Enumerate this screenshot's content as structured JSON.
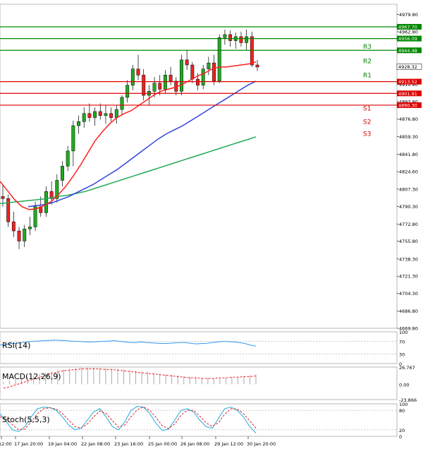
{
  "chart_data": [
    {
      "type": "candlestick",
      "name": "price",
      "ylim": [
        4669.8,
        4990
      ],
      "y_ticks": [
        "4979.80",
        "4962.80",
        "4945.80",
        "4928.80",
        "4910.80",
        "4893.80",
        "4876.80",
        "4859.30",
        "4841.80",
        "4824.60",
        "4807.30",
        "4790.30",
        "4772.80",
        "4755.80",
        "4738.30",
        "4721.30",
        "4704.30",
        "4686.80",
        "4669.80"
      ],
      "x_ticks": [
        "12:00",
        "17 Jan 20:00",
        "19 Jan 04:00",
        "22 Jan 08:00",
        "23 Jan 16:00",
        "25 Jan 00:00",
        "26 Jan 08:00",
        "29 Jan 12:00",
        "30 Jan 20:00"
      ],
      "current_price": "4928.32",
      "colors": {
        "up": "#22aa22",
        "down": "#ee2222",
        "ma_fast": "#ff2020",
        "ma_mid": "#3344dd",
        "ma_slow": "#22aa55",
        "resistance": "#008800",
        "support": "#dd0000"
      },
      "levels": [
        {
          "name": "R3",
          "value": 4967.7,
          "label": "4967.70",
          "kind": "resistance"
        },
        {
          "name": "R2",
          "value": 4956.09,
          "label": "4956.09",
          "kind": "resistance"
        },
        {
          "name": "R1",
          "value": 4944.48,
          "label": "4944.48",
          "kind": "resistance"
        },
        {
          "name": "S1",
          "value": 4913.52,
          "label": "4913.52",
          "kind": "support"
        },
        {
          "name": "S2",
          "value": 4901.91,
          "label": "4901.91",
          "kind": "support"
        },
        {
          "name": "S3",
          "value": 4890.3,
          "label": "4890.30",
          "kind": "support"
        }
      ],
      "level_tags": [
        {
          "name": "R3",
          "value": 4948
        },
        {
          "name": "R2",
          "value": 4934
        },
        {
          "name": "R1",
          "value": 4920
        },
        {
          "name": "S1",
          "value": 4887
        },
        {
          "name": "S2",
          "value": 4874
        },
        {
          "name": "S3",
          "value": 4862
        }
      ],
      "candles": [
        [
          4800,
          4812,
          4790,
          4798
        ],
        [
          4798,
          4802,
          4770,
          4775
        ],
        [
          4775,
          4785,
          4760,
          4766
        ],
        [
          4766,
          4770,
          4748,
          4756
        ],
        [
          4756,
          4772,
          4750,
          4768
        ],
        [
          4768,
          4780,
          4762,
          4770
        ],
        [
          4770,
          4795,
          4766,
          4790
        ],
        [
          4790,
          4800,
          4780,
          4784
        ],
        [
          4784,
          4810,
          4780,
          4805
        ],
        [
          4805,
          4815,
          4792,
          4798
        ],
        [
          4798,
          4822,
          4794,
          4816
        ],
        [
          4816,
          4835,
          4810,
          4830
        ],
        [
          4830,
          4850,
          4825,
          4845
        ],
        [
          4845,
          4875,
          4830,
          4870
        ],
        [
          4870,
          4880,
          4862,
          4874
        ],
        [
          4874,
          4888,
          4868,
          4882
        ],
        [
          4882,
          4892,
          4874,
          4878
        ],
        [
          4878,
          4888,
          4870,
          4884
        ],
        [
          4884,
          4892,
          4876,
          4880
        ],
        [
          4880,
          4890,
          4872,
          4882
        ],
        [
          4882,
          4888,
          4874,
          4878
        ],
        [
          4878,
          4890,
          4872,
          4886
        ],
        [
          4886,
          4900,
          4880,
          4898
        ],
        [
          4898,
          4915,
          4893,
          4910
        ],
        [
          4910,
          4930,
          4905,
          4926
        ],
        [
          4926,
          4940,
          4915,
          4920
        ],
        [
          4920,
          4926,
          4895,
          4900
        ],
        [
          4900,
          4910,
          4890,
          4904
        ],
        [
          4904,
          4918,
          4898,
          4912
        ],
        [
          4912,
          4920,
          4900,
          4906
        ],
        [
          4906,
          4925,
          4902,
          4920
        ],
        [
          4920,
          4928,
          4910,
          4914
        ],
        [
          4914,
          4918,
          4900,
          4904
        ],
        [
          4904,
          4940,
          4900,
          4935
        ],
        [
          4935,
          4945,
          4925,
          4930
        ],
        [
          4930,
          4933,
          4912,
          4916
        ],
        [
          4916,
          4922,
          4905,
          4910
        ],
        [
          4910,
          4930,
          4906,
          4926
        ],
        [
          4926,
          4938,
          4920,
          4932
        ],
        [
          4932,
          4940,
          4910,
          4914
        ],
        [
          4914,
          4960,
          4912,
          4957
        ],
        [
          4957,
          4965,
          4950,
          4960
        ],
        [
          4960,
          4964,
          4948,
          4954
        ],
        [
          4954,
          4962,
          4946,
          4958
        ],
        [
          4958,
          4963,
          4948,
          4952
        ],
        [
          4952,
          4965,
          4945,
          4958
        ],
        [
          4958,
          4963,
          4928,
          4930
        ],
        [
          4930,
          4935,
          4924,
          4928
        ]
      ],
      "ma_fast": [
        4815,
        4806,
        4797,
        4790,
        4787,
        4788,
        4791,
        4795,
        4802,
        4810,
        4820,
        4831,
        4843,
        4855,
        4864,
        4872,
        4878,
        4882,
        4885,
        4890,
        4895,
        4900,
        4904,
        4906,
        4908,
        4911,
        4915,
        4919,
        4922,
        4926,
        4928,
        4928,
        4929,
        4930,
        4931,
        4933
      ],
      "ma_mid": [
        4790,
        4791,
        4792,
        4794,
        4797,
        4800,
        4804,
        4808,
        4812,
        4817,
        4822,
        4827,
        4833,
        4839,
        4845,
        4851,
        4857,
        4862,
        4866,
        4870,
        4875,
        4880,
        4885,
        4890,
        4895,
        4900,
        4905,
        4910,
        4914
      ],
      "ma_slow": [
        4793,
        4794,
        4795,
        4796,
        4797,
        4798,
        4800,
        4801,
        4803,
        4805,
        4808,
        4811,
        4814,
        4817,
        4820,
        4823,
        4826,
        4829,
        4832,
        4835,
        4838,
        4841,
        4844,
        4847,
        4850,
        4853,
        4856,
        4859
      ],
      "grid": true
    },
    {
      "type": "line",
      "name": "RSI(14)",
      "title": "RSI(14)",
      "y_ticks": [
        "100",
        "70",
        "30",
        "0"
      ],
      "ylim": [
        0,
        100
      ],
      "values": [
        58,
        60,
        63,
        64,
        66,
        68,
        70,
        71,
        72,
        73,
        74,
        73,
        72,
        71,
        70,
        69,
        68,
        68,
        69,
        70,
        71,
        72,
        70,
        68,
        66,
        66,
        68,
        66,
        65,
        64,
        63,
        64,
        65,
        66,
        66,
        64,
        62,
        63,
        64,
        66,
        68,
        70,
        69,
        68,
        66,
        63,
        58,
        55
      ]
    },
    {
      "type": "bar",
      "name": "MACD(12,26,9)",
      "title": "MACD(12,26,9)",
      "y_ticks": [
        "26.767",
        "0.00",
        "-23.866"
      ],
      "ylim": [
        -23.866,
        26.767
      ],
      "histogram": [
        4,
        6,
        8,
        10,
        12,
        14,
        16,
        18,
        20,
        22,
        23,
        24,
        25,
        26,
        26,
        26,
        25,
        25,
        24,
        24,
        23,
        22,
        21,
        20,
        19,
        18,
        17,
        16,
        15,
        14,
        13,
        12,
        11,
        10,
        10,
        9,
        9,
        10,
        11,
        12,
        13,
        14,
        15
      ],
      "signal": [
        -6,
        -4,
        -1,
        2,
        5,
        8,
        11,
        14,
        17,
        19,
        21,
        22,
        23,
        24,
        24,
        24,
        24,
        23,
        23,
        22,
        21,
        20,
        19,
        18,
        17,
        16,
        15,
        14,
        13,
        12,
        11,
        10,
        10,
        9,
        9,
        9,
        10,
        10,
        11,
        11,
        12,
        12,
        13
      ]
    },
    {
      "type": "line",
      "name": "Stoch(5,5,3)",
      "title": "Stoch(5,5,3)",
      "y_ticks": [
        "100",
        "80",
        "20",
        "0"
      ],
      "ylim": [
        0,
        100
      ],
      "series": [
        {
          "color": "#22aadd",
          "values": [
            70,
            45,
            20,
            15,
            30,
            60,
            85,
            90,
            88,
            80,
            60,
            35,
            20,
            25,
            50,
            75,
            85,
            60,
            30,
            20,
            45,
            80,
            92,
            90,
            70,
            40,
            18,
            22,
            50,
            80,
            85,
            75,
            50,
            30,
            25,
            55,
            85,
            90,
            80,
            60,
            30,
            10
          ]
        },
        {
          "color": "#dd2222",
          "values": [
            60,
            55,
            35,
            20,
            22,
            45,
            70,
            85,
            88,
            84,
            70,
            50,
            30,
            25,
            38,
            60,
            78,
            70,
            48,
            28,
            35,
            60,
            82,
            90,
            80,
            58,
            32,
            24,
            38,
            65,
            80,
            80,
            62,
            42,
            30,
            42,
            68,
            85,
            84,
            70,
            48,
            25
          ]
        }
      ]
    }
  ]
}
